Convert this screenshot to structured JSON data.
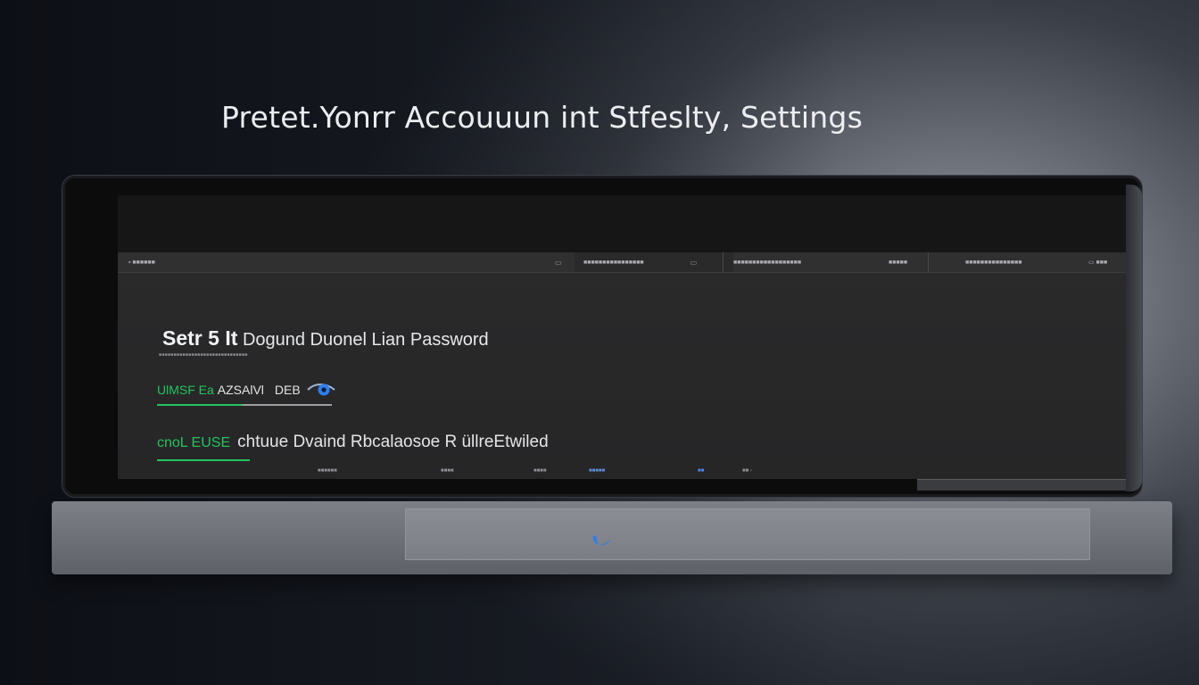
{
  "headline": "Pretet.Yonrr Accouuun int Stfeslty, Settings",
  "topbar": {
    "app_label": "▪ ■■■■■■",
    "seg1_icon_label": "▭",
    "seg2_label": "■■■■■■■■■■■■■■■■",
    "seg2_icon_label": "▭",
    "seg3_label": "■■■■■■■■■■■■■■■■■■",
    "seg4_label": "■■■■■",
    "seg5_label": "■■■■■■■■■■■■■■■",
    "seg6_label": "▭ ■■■"
  },
  "form": {
    "title_lead": "Setr 5 It",
    "title_rest": "Dogund Duonel Lian Password",
    "subtitle": "■■■■■■■■■■■■■■■■■■■■■■■■■■■■■■",
    "field1": {
      "label": "UlMSF Ea",
      "value": "AZSAlVl",
      "suffix": "DEB"
    },
    "field2": {
      "label": "cnoL EUSE",
      "value": "chtuue Dvaind  Rbcalaosoe R üllreEtwiled"
    }
  },
  "bottom_bar": {
    "item1": "■■■■■■",
    "item2": "■■■■",
    "item3": "■■■■",
    "item4": "■■■■■",
    "item5": "■■",
    "item6": "■■ ›"
  },
  "colors": {
    "accent_green": "#22c55e",
    "accent_blue": "#2d7ff0"
  },
  "icons": {
    "eye": "eye-icon",
    "brand": "swoosh-logo-icon"
  }
}
